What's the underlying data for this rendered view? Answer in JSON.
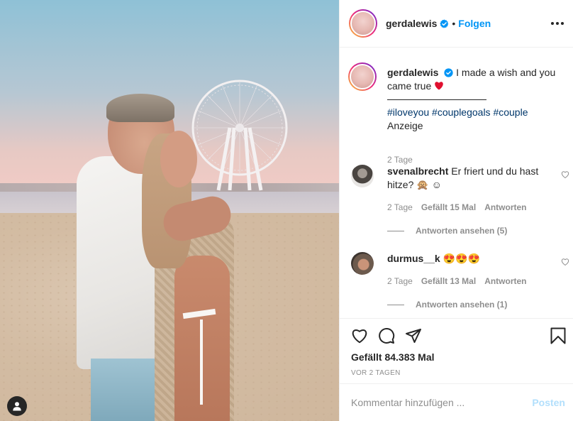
{
  "post": {
    "username": "gerdalewis",
    "follow_label": "Folgen",
    "dot": "•",
    "user_tag_icon": "user-icon"
  },
  "caption": {
    "username": "gerdalewis",
    "text": "I made a wish and you came true",
    "hashtags": [
      "#iloveyou",
      "#couplegoals",
      "#couple"
    ],
    "sponsored": "Anzeige",
    "time": "2 Tage"
  },
  "comments": [
    {
      "username": "svenalbrecht",
      "text": "Er friert und du hast hitze?",
      "emojis": "🙊 ☺",
      "time": "2 Tage",
      "likes": "Gefällt 15 Mal",
      "reply_label": "Antworten",
      "view_replies": "Antworten ansehen (5)"
    },
    {
      "username": "durmus__k",
      "text": "",
      "emojis": "😍😍😍",
      "time": "2 Tage",
      "likes": "Gefällt 13 Mal",
      "reply_label": "Antworten",
      "view_replies": "Antworten ansehen (1)"
    }
  ],
  "actions": {
    "icons": [
      "heart-icon",
      "comment-icon",
      "share-icon",
      "bookmark-icon"
    ],
    "likes": "Gefällt 84.383 Mal",
    "date": "VOR 2 TAGEN"
  },
  "comment_box": {
    "placeholder": "Kommentar hinzufügen ...",
    "post_label": "Posten"
  },
  "colors": {
    "accent": "#0095f6",
    "link": "#00376b",
    "muted": "#8e8e8e",
    "post_disabled": "#b2dffc",
    "heart": "#ed4956"
  }
}
